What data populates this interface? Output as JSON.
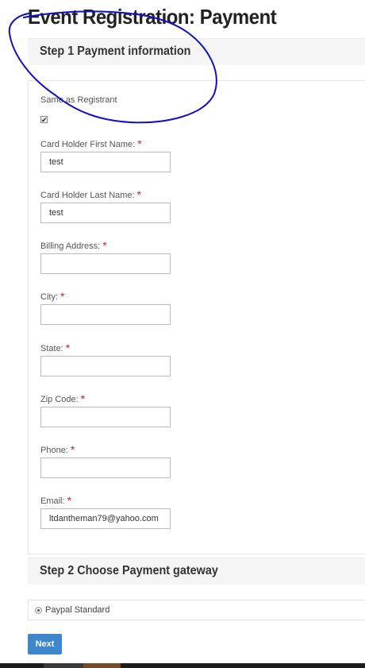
{
  "page": {
    "title": "Event Registration: Payment"
  },
  "step1": {
    "heading": "Step 1 Payment information",
    "same_as_registrant": {
      "label": "Same as Registrant",
      "checked": true
    },
    "required_marker": "*",
    "fields": [
      {
        "label": "Card Holder First Name:",
        "value": "test"
      },
      {
        "label": "Card Holder Last Name:",
        "value": "test"
      },
      {
        "label": "Billing Address:",
        "value": ""
      },
      {
        "label": "City:",
        "value": ""
      },
      {
        "label": "State:",
        "value": ""
      },
      {
        "label": "Zip Code:",
        "value": ""
      },
      {
        "label": "Phone:",
        "value": ""
      },
      {
        "label": "Email:",
        "value": "ltdantheman79@yahoo.com"
      }
    ]
  },
  "step2": {
    "heading": "Step 2 Choose Payment gateway",
    "gateway": {
      "label": "Paypal Standard",
      "selected": true
    }
  },
  "actions": {
    "next_label": "Next"
  },
  "colors": {
    "accent": "#3d87cc",
    "required": "#d9232d",
    "annotation_ink": "#1010c8"
  }
}
